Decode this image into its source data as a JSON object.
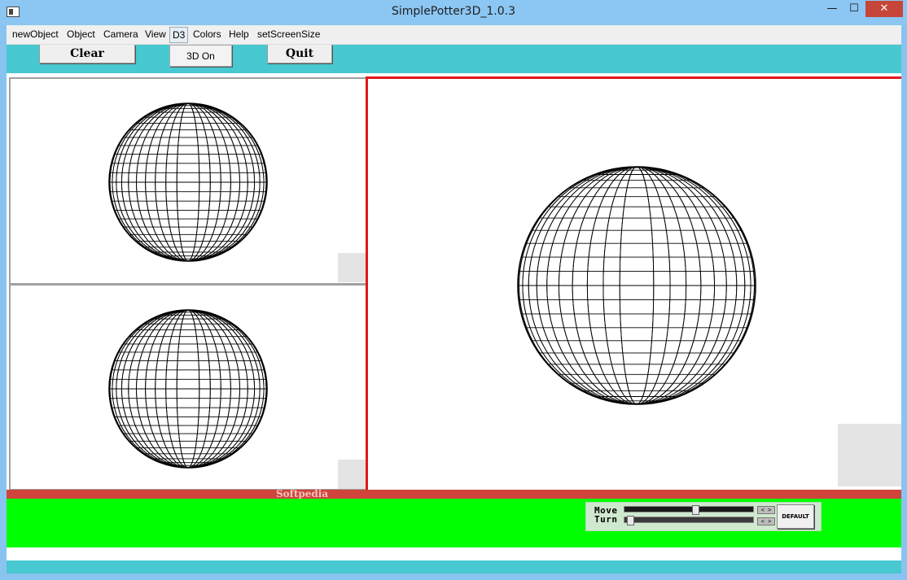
{
  "window": {
    "title": "SimplePotter3D_1.0.3",
    "min_symbol": "—",
    "max_symbol": "☐",
    "close_symbol": "✕"
  },
  "menu": {
    "items": [
      "newObject",
      "Object",
      "Camera",
      "View",
      "D3",
      "Colors",
      "Help",
      "setScreenSize"
    ]
  },
  "toolbar": {
    "clear_label": "Clear",
    "d3_on_label": "3D On",
    "quit_label": "Quit"
  },
  "status": {
    "watermark": "Softpedia"
  },
  "controls": {
    "move_label": "Move",
    "turn_label": "Turn",
    "move_spin": "< >",
    "turn_spin": "< >",
    "default_label": "DEFAULT",
    "move_value": 0.56,
    "turn_value": 0.02
  },
  "colors": {
    "toolbar_bg": "#48c8d0",
    "active_viewport_border": "#e01818",
    "status_strip": "#d0443c",
    "control_panel_bg": "#00ff00"
  }
}
